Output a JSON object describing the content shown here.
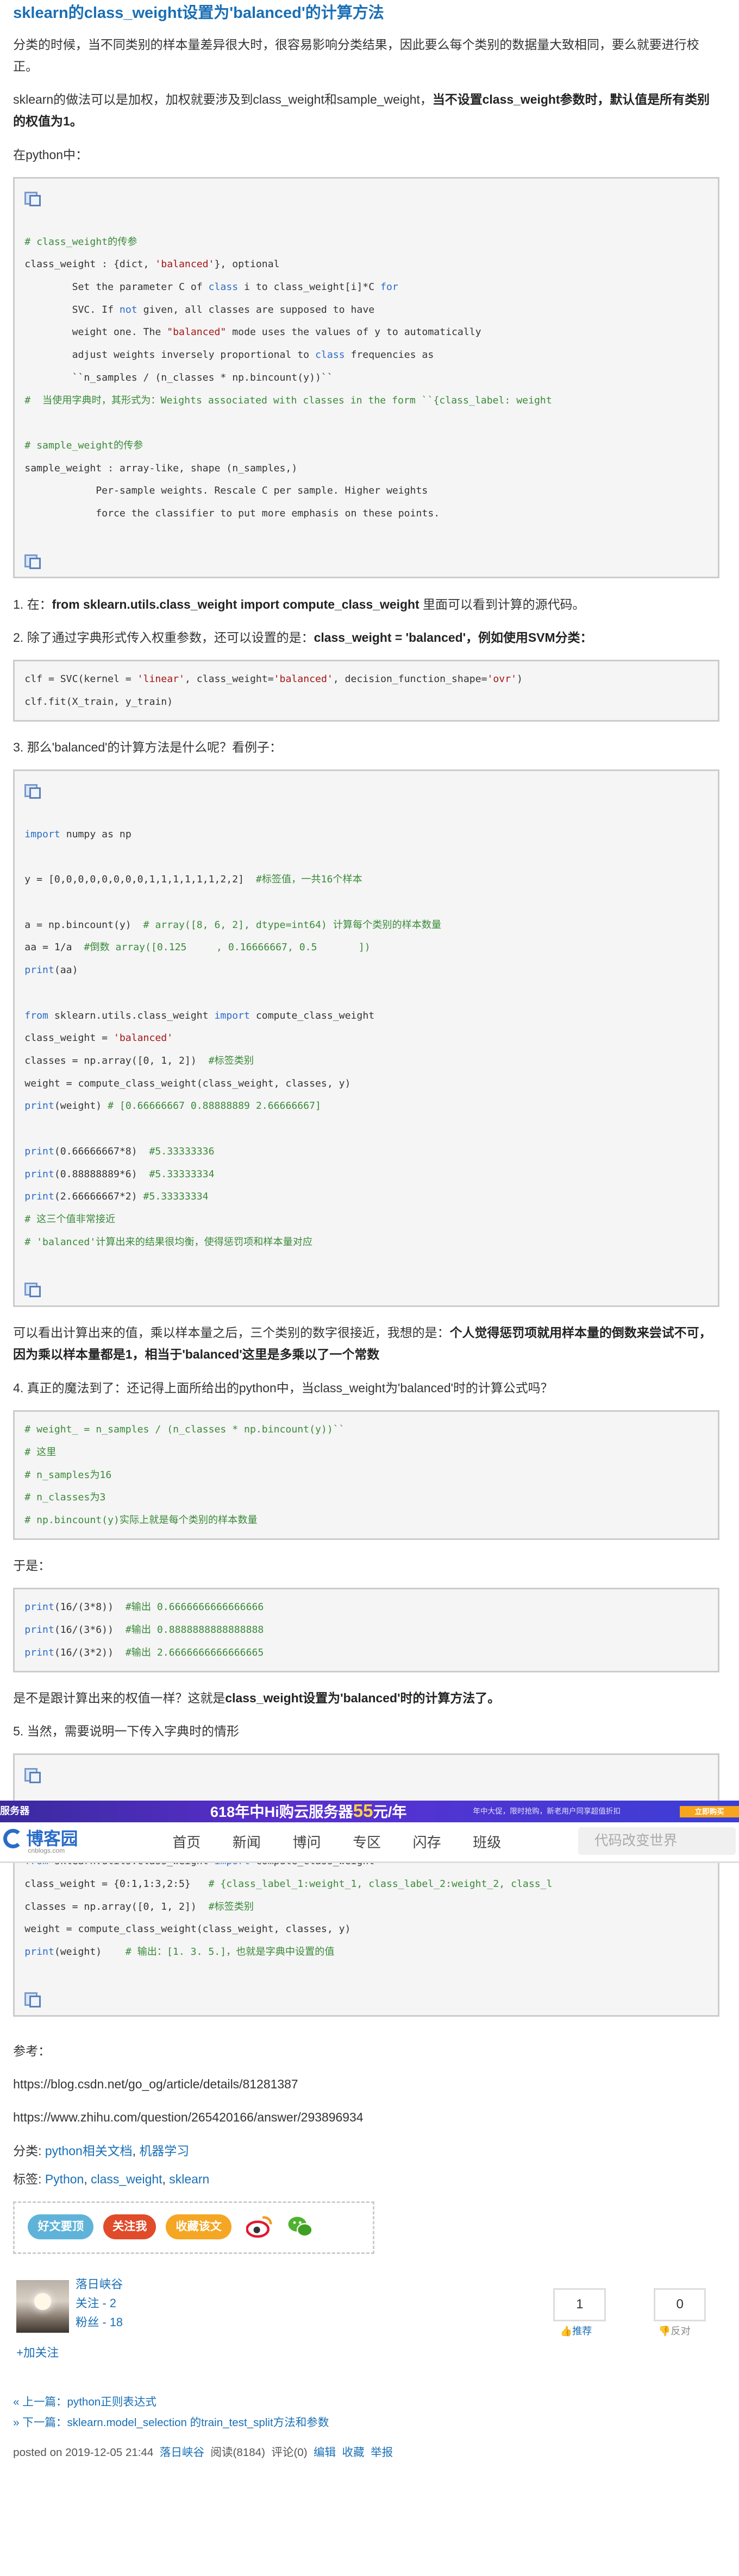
{
  "title": "sklearn的class_weight设置为'balanced'的计算方法",
  "intro_p1": "分类的时候，当不同类别的样本量差异很大时，很容易影响分类结果，因此要么每个类别的数据量大致相同，要么就要进行校正。",
  "intro_p2_a": "sklearn的做法可以是加权，加权就要涉及到class_weight和sample_weight，",
  "intro_p2_b": "当不设置class_weight参数时，默认值是所有类别的权值为1。",
  "intro_p3": "在python中：",
  "code1": [
    {
      "t": "icon"
    },
    {
      "t": "blank"
    },
    {
      "t": "line",
      "parts": [
        {
          "c": "cmt",
          "v": "# class_weight的传参"
        }
      ]
    },
    {
      "t": "line",
      "parts": [
        {
          "c": "",
          "v": "class_weight : {dict, "
        },
        {
          "c": "str",
          "v": "'balanced'"
        },
        {
          "c": "",
          "v": "}, optional"
        }
      ]
    },
    {
      "t": "line",
      "parts": [
        {
          "c": "",
          "v": "        Set the parameter C of "
        },
        {
          "c": "kw",
          "v": "class"
        },
        {
          "c": "",
          "v": " i to class_weight[i]*C "
        },
        {
          "c": "kw",
          "v": "for"
        }
      ]
    },
    {
      "t": "line",
      "parts": [
        {
          "c": "",
          "v": "        SVC. If "
        },
        {
          "c": "kw",
          "v": "not"
        },
        {
          "c": "",
          "v": " given, all classes are supposed to have"
        }
      ]
    },
    {
      "t": "line",
      "parts": [
        {
          "c": "",
          "v": "        weight one. The "
        },
        {
          "c": "str",
          "v": "\"balanced\""
        },
        {
          "c": "",
          "v": " mode uses the values of y to automatically"
        }
      ]
    },
    {
      "t": "line",
      "parts": [
        {
          "c": "",
          "v": "        adjust weights inversely proportional to "
        },
        {
          "c": "kw",
          "v": "class"
        },
        {
          "c": "",
          "v": " frequencies as"
        }
      ]
    },
    {
      "t": "line",
      "parts": [
        {
          "c": "",
          "v": "        ``n_samples / (n_classes * np.bincount(y))``"
        }
      ]
    },
    {
      "t": "line",
      "parts": [
        {
          "c": "cmt",
          "v": "#  当使用字典时，其形式为：Weights associated with classes in the form ``{class_label: weight"
        }
      ]
    },
    {
      "t": "blank"
    },
    {
      "t": "line",
      "parts": [
        {
          "c": "cmt",
          "v": "# sample_weight的传参"
        }
      ]
    },
    {
      "t": "line",
      "parts": [
        {
          "c": "",
          "v": "sample_weight : array-like, shape (n_samples,)"
        }
      ]
    },
    {
      "t": "line",
      "parts": [
        {
          "c": "",
          "v": "            Per-sample weights. Rescale C per sample. Higher weights"
        }
      ]
    },
    {
      "t": "line",
      "parts": [
        {
          "c": "",
          "v": "            force the classifier to put more emphasis on these points."
        }
      ]
    },
    {
      "t": "blank"
    },
    {
      "t": "icon"
    }
  ],
  "step1_a": "1. 在：",
  "step1_b": "from sklearn.utils.class_weight import compute_class_weight",
  "step1_c": " 里面可以看到计算的源代码。",
  "step2_a": "2. 除了通过字典形式传入权重参数，还可以设置的是：",
  "step2_b": "class_weight = 'balanced'，例如使用SVM分类：",
  "code2": [
    {
      "t": "line",
      "parts": [
        {
          "c": "",
          "v": "clf = SVC(kernel = "
        },
        {
          "c": "str",
          "v": "'linear'"
        },
        {
          "c": "",
          "v": ", class_weight="
        },
        {
          "c": "str",
          "v": "'balanced'"
        },
        {
          "c": "",
          "v": ", decision_function_shape="
        },
        {
          "c": "str",
          "v": "'ovr'"
        },
        {
          "c": "",
          "v": ")"
        }
      ]
    },
    {
      "t": "line",
      "parts": [
        {
          "c": "",
          "v": "clf.fit(X_train, y_train)"
        }
      ]
    }
  ],
  "step3": "3. 那么'balanced'的计算方法是什么呢？看例子：",
  "code3": [
    {
      "t": "icon"
    },
    {
      "t": "blank"
    },
    {
      "t": "line",
      "parts": [
        {
          "c": "kw",
          "v": "import"
        },
        {
          "c": "",
          "v": " numpy as np"
        }
      ]
    },
    {
      "t": "blank"
    },
    {
      "t": "line",
      "parts": [
        {
          "c": "",
          "v": "y = [0,0,0,0,0,0,0,0,1,1,1,1,1,1,2,2]  "
        },
        {
          "c": "cmt",
          "v": "#标签值，一共16个样本"
        }
      ]
    },
    {
      "t": "blank"
    },
    {
      "t": "line",
      "parts": [
        {
          "c": "",
          "v": "a = np.bincount(y)  "
        },
        {
          "c": "cmt",
          "v": "# array([8, 6, 2], dtype=int64) 计算每个类别的样本数量"
        }
      ]
    },
    {
      "t": "line",
      "parts": [
        {
          "c": "",
          "v": "aa = 1/a  "
        },
        {
          "c": "cmt",
          "v": "#倒数 array([0.125     , 0.16666667, 0.5       ])"
        }
      ]
    },
    {
      "t": "line",
      "parts": [
        {
          "c": "kw",
          "v": "print"
        },
        {
          "c": "",
          "v": "(aa)"
        }
      ]
    },
    {
      "t": "blank"
    },
    {
      "t": "line",
      "parts": [
        {
          "c": "kw",
          "v": "from"
        },
        {
          "c": "",
          "v": " sklearn.utils.class_weight "
        },
        {
          "c": "kw",
          "v": "import"
        },
        {
          "c": "",
          "v": " compute_class_weight"
        }
      ]
    },
    {
      "t": "line",
      "parts": [
        {
          "c": "",
          "v": "class_weight = "
        },
        {
          "c": "str",
          "v": "'balanced'"
        }
      ]
    },
    {
      "t": "line",
      "parts": [
        {
          "c": "",
          "v": "classes = np.array([0, 1, 2])  "
        },
        {
          "c": "cmt",
          "v": "#标签类别"
        }
      ]
    },
    {
      "t": "line",
      "parts": [
        {
          "c": "",
          "v": "weight = compute_class_weight(class_weight, classes, y)"
        }
      ]
    },
    {
      "t": "line",
      "parts": [
        {
          "c": "kw",
          "v": "print"
        },
        {
          "c": "",
          "v": "(weight) "
        },
        {
          "c": "cmt",
          "v": "# [0.66666667 0.88888889 2.66666667]"
        }
      ]
    },
    {
      "t": "blank"
    },
    {
      "t": "line",
      "parts": [
        {
          "c": "kw",
          "v": "print"
        },
        {
          "c": "",
          "v": "(0.66666667*8)  "
        },
        {
          "c": "cmt",
          "v": "#5.33333336"
        }
      ]
    },
    {
      "t": "line",
      "parts": [
        {
          "c": "kw",
          "v": "print"
        },
        {
          "c": "",
          "v": "(0.88888889*6)  "
        },
        {
          "c": "cmt",
          "v": "#5.33333334"
        }
      ]
    },
    {
      "t": "line",
      "parts": [
        {
          "c": "kw",
          "v": "print"
        },
        {
          "c": "",
          "v": "(2.66666667*2) "
        },
        {
          "c": "cmt",
          "v": "#5.33333334"
        }
      ]
    },
    {
      "t": "line",
      "parts": [
        {
          "c": "cmt",
          "v": "# 这三个值非常接近"
        }
      ]
    },
    {
      "t": "line",
      "parts": [
        {
          "c": "cmt",
          "v": "# 'balanced'计算出来的结果很均衡，使得惩罚项和样本量对应"
        }
      ]
    },
    {
      "t": "blank"
    },
    {
      "t": "icon"
    }
  ],
  "para_a": "可以看出计算出来的值，乘以样本量之后，三个类别的数字很接近，我想的是：",
  "para_b": "个人觉得惩罚项就用样本量的倒数来尝试不可，因为乘以样本量都是1，相当于'balanced'这里是多乘以了一个常数",
  "step4_a": "4. 真正的魔法到了：还记得上面所给出的python中，当class_weight为'balanced'时的计算公式吗？",
  "code4": [
    {
      "t": "line",
      "parts": [
        {
          "c": "cmt",
          "v": "# weight_ = n_samples / (n_classes * np.bincount(y))``"
        }
      ]
    },
    {
      "t": "line",
      "parts": [
        {
          "c": "cmt",
          "v": "# 这里"
        }
      ]
    },
    {
      "t": "line",
      "parts": [
        {
          "c": "cmt",
          "v": "# n_samples为16"
        }
      ]
    },
    {
      "t": "line",
      "parts": [
        {
          "c": "cmt",
          "v": "# n_classes为3"
        }
      ]
    },
    {
      "t": "line",
      "parts": [
        {
          "c": "cmt",
          "v": "# np.bincount(y)实际上就是每个类别的样本数量"
        }
      ]
    }
  ],
  "so": "于是：",
  "code5": [
    {
      "t": "line",
      "parts": [
        {
          "c": "kw",
          "v": "print"
        },
        {
          "c": "",
          "v": "(16/(3*8))  "
        },
        {
          "c": "cmt",
          "v": "#输出 0.6666666666666666"
        }
      ]
    },
    {
      "t": "line",
      "parts": [
        {
          "c": "kw",
          "v": "print"
        },
        {
          "c": "",
          "v": "(16/(3*6))  "
        },
        {
          "c": "cmt",
          "v": "#输出 0.8888888888888888"
        }
      ]
    },
    {
      "t": "line",
      "parts": [
        {
          "c": "kw",
          "v": "print"
        },
        {
          "c": "",
          "v": "(16/(3*2))  "
        },
        {
          "c": "cmt",
          "v": "#输出 2.6666666666666665"
        }
      ]
    }
  ],
  "conclusion_a": "是不是跟计算出来的权值一样？这就是",
  "conclusion_b": "class_weight设置为'balanced'时的计算方法了。",
  "step5": " 5. 当然，需要说明一下传入字典时的情形",
  "code6_top": [
    {
      "t": "icon"
    }
  ],
  "banner": {
    "ad_left": "服务器",
    "ad_main": "618年中Hi购云服务器",
    "ad_price": "55",
    "ad_unit": "元/年",
    "ad_small": "年中大促，限时抢购，新老用户同享超值折扣",
    "ad_btn": "立即购买",
    "logo_text": "博客园",
    "logo_sub": "cnblogs.com",
    "nav_items": [
      "首页",
      "新闻",
      "博问",
      "专区",
      "闪存",
      "班级"
    ],
    "search_placeholder": "代码改变世界"
  },
  "code6": [
    {
      "t": "line",
      "parts": [
        {
          "c": "kw",
          "v": "from"
        },
        {
          "c": "",
          "v": " sklearn.utils.class_weight "
        },
        {
          "c": "kw",
          "v": "import"
        },
        {
          "c": "",
          "v": " compute_class_weight"
        }
      ]
    },
    {
      "t": "line",
      "parts": [
        {
          "c": "",
          "v": "class_weight = {0:1,1:3,2:5}   "
        },
        {
          "c": "cmt",
          "v": "# {class_label_1:weight_1, class_label_2:weight_2, class_l"
        }
      ]
    },
    {
      "t": "line",
      "parts": [
        {
          "c": "",
          "v": "classes = np.array([0, 1, 2])  "
        },
        {
          "c": "cmt",
          "v": "#标签类别"
        }
      ]
    },
    {
      "t": "line",
      "parts": [
        {
          "c": "",
          "v": "weight = compute_class_weight(class_weight, classes, y)"
        }
      ]
    },
    {
      "t": "line",
      "parts": [
        {
          "c": "kw",
          "v": "print"
        },
        {
          "c": "",
          "v": "(weight)    "
        },
        {
          "c": "cmt",
          "v": "# 输出：[1. 3. 5.]，也就是字典中设置的值"
        }
      ]
    },
    {
      "t": "blank"
    },
    {
      "t": "icon"
    }
  ],
  "ref_label": "参考：",
  "ref1": "https://blog.csdn.net/go_og/article/details/81281387",
  "ref2": "https://www.zhihu.com/question/265420166/answer/293896934",
  "cat_label": "分类: ",
  "cat1": "python相关文档",
  "cat2": "机器学习",
  "tag_label": "标签: ",
  "tag1": "Python",
  "tag2": "class_weight",
  "tag3": "sklearn",
  "share": {
    "b1": "好文要顶",
    "b2": "关注我",
    "b3": "收藏该文",
    "c1": "#5fb3d9",
    "c2": "#e04b2a",
    "c3": "#f5a623"
  },
  "author": {
    "name": "落日峡谷",
    "following": "关注 - 2",
    "fans": "粉丝 - 18",
    "follow_btn": "+加关注"
  },
  "vote": {
    "up": "1",
    "up_label": "推荐",
    "down": "0",
    "down_label": "反对"
  },
  "prev_label": "« 上一篇：",
  "prev_link": "python正则表达式",
  "next_label": "» 下一篇：",
  "next_link": "sklearn.model_selection 的train_test_split方法和参数",
  "footer": {
    "posted": "posted on 2019-12-05 21:44",
    "author": "落日峡谷",
    "reads": "阅读(8184)",
    "comments": "评论(0)",
    "edit": "编辑",
    "fav": "收藏",
    "report": "举报"
  }
}
